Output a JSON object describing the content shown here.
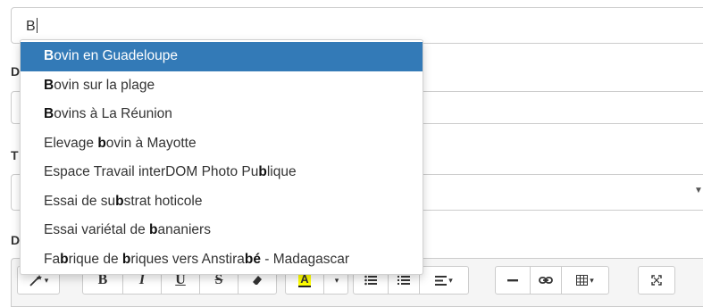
{
  "search": {
    "value": "B"
  },
  "labels": [
    "D",
    "T",
    "D"
  ],
  "select": {
    "arrow_icon": "caret-down-icon"
  },
  "toolbar": {
    "magic": "magic-wand-icon",
    "bold": "B",
    "italic": "I",
    "underline": "U",
    "strikethrough": "S",
    "eraser": "eraser-icon",
    "highlight": "A",
    "ul": "unordered-list-icon",
    "ol": "ordered-list-icon",
    "align": "align-icon",
    "hr": "horizontal-rule-icon",
    "link": "link-icon",
    "table": "table-icon",
    "fullscreen": "fullscreen-icon",
    "highlight_color": "#ffff00"
  },
  "suggestions": {
    "active_index": 0,
    "items": [
      {
        "before": "",
        "match": "B",
        "after": "ovin en Guadeloupe"
      },
      {
        "before": "",
        "match": "B",
        "after": "ovin sur la plage"
      },
      {
        "before": "",
        "match": "B",
        "after": "ovins à La Réunion"
      },
      {
        "before": "Elevage ",
        "match": "b",
        "after": "ovin à Mayotte"
      },
      {
        "before": "Espace Travail interDOM Photo Pu",
        "match": "b",
        "after": "lique"
      },
      {
        "before": "Essai de su",
        "match": "b",
        "after": "strat hoticole"
      },
      {
        "before": "Essai variétal de ",
        "match": "b",
        "after": "ananiers"
      },
      {
        "before": "Fa",
        "match": "b",
        "after": "rique de ",
        "match2": "b",
        "after2": "riques vers Anstira",
        "match3": "bé",
        "after3": " - Madagascar"
      }
    ],
    "active_color": "#337ab7"
  }
}
